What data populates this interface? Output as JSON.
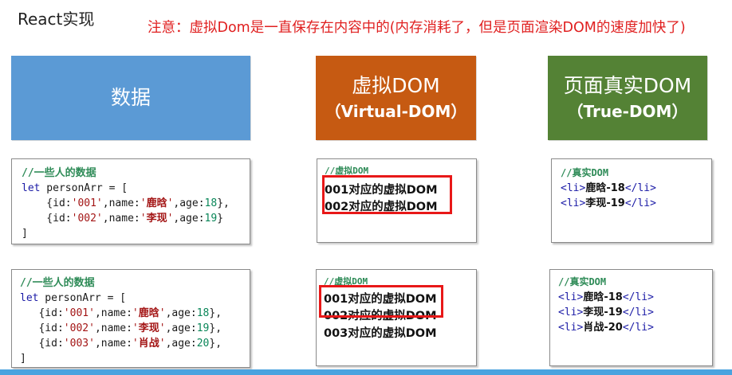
{
  "title": "React实现",
  "note": "注意：虚拟Dom是一直保存在内容中的(内存消耗了，但是页面渲染DOM的速度加快了)",
  "headers": {
    "data": {
      "line1": "数据"
    },
    "vdom": {
      "line1": "虚拟DOM",
      "line2": "（Virtual-DOM）"
    },
    "tdom": {
      "line1": "页面真实DOM",
      "line2": "（True-DOM）"
    }
  },
  "data_panel_1": {
    "comment": "//一些人的数据",
    "kw_let": "let",
    "decl": " personArr = [",
    "rows": [
      {
        "pre": "    {id:",
        "id": "'001'",
        "mid": ",name:",
        "q1": "'",
        "name": "鹿晗",
        "q2": "'",
        "agek": ",age:",
        "age": "18",
        "post": "},"
      },
      {
        "pre": "    {id:",
        "id": "'002'",
        "mid": ",name:",
        "q1": "'",
        "name": "李现",
        "q2": "'",
        "agek": ",age:",
        "age": "19",
        "post": "}"
      }
    ],
    "close": "]"
  },
  "data_panel_2": {
    "comment": "//一些人的数据",
    "kw_let": "let",
    "decl": " personArr = [",
    "rows": [
      {
        "pre": "   {id:",
        "id": "'001'",
        "mid": ",name:",
        "q1": "'",
        "name": "鹿晗",
        "q2": "'",
        "agek": ",age:",
        "age": "18",
        "post": "},"
      },
      {
        "pre": "   {id:",
        "id": "'002'",
        "mid": ",name:",
        "q1": "'",
        "name": "李现",
        "q2": "'",
        "agek": ",age:",
        "age": "19",
        "post": "},"
      },
      {
        "pre": "   {id:",
        "id": "'003'",
        "mid": ",name:",
        "q1": "'",
        "name": "肖战",
        "q2": "'",
        "agek": ",age:",
        "age": "20",
        "post": "},"
      }
    ],
    "close": "]"
  },
  "vdom_panel_1": {
    "comment": "//虚拟DOM",
    "items": [
      "001对应的虚拟DOM",
      "002对应的虚拟DOM"
    ]
  },
  "vdom_panel_2": {
    "comment": "//虚拟DOM",
    "items": [
      "001对应的虚拟DOM",
      "002对应的虚拟DOM",
      "003对应的虚拟DOM"
    ]
  },
  "tdom_panel_1": {
    "comment": "//真实DOM",
    "items": [
      {
        "open": "<li>",
        "text": "鹿晗-18",
        "close": "</li>"
      },
      {
        "open": "<li>",
        "text": "李现-19",
        "close": "</li>"
      }
    ]
  },
  "tdom_panel_2": {
    "comment": "//真实DOM",
    "items": [
      {
        "open": "<li>",
        "text": "鹿晗-18",
        "close": "</li>"
      },
      {
        "open": "<li>",
        "text": "李现-19",
        "close": "</li>"
      },
      {
        "open": "<li>",
        "text": "肖战-20",
        "close": "</li>"
      }
    ]
  },
  "colors": {
    "data_header": "#5b9ad5",
    "vdom_header": "#c65a12",
    "tdom_header": "#548235",
    "highlight": "#e81818",
    "note": "#e02020"
  }
}
